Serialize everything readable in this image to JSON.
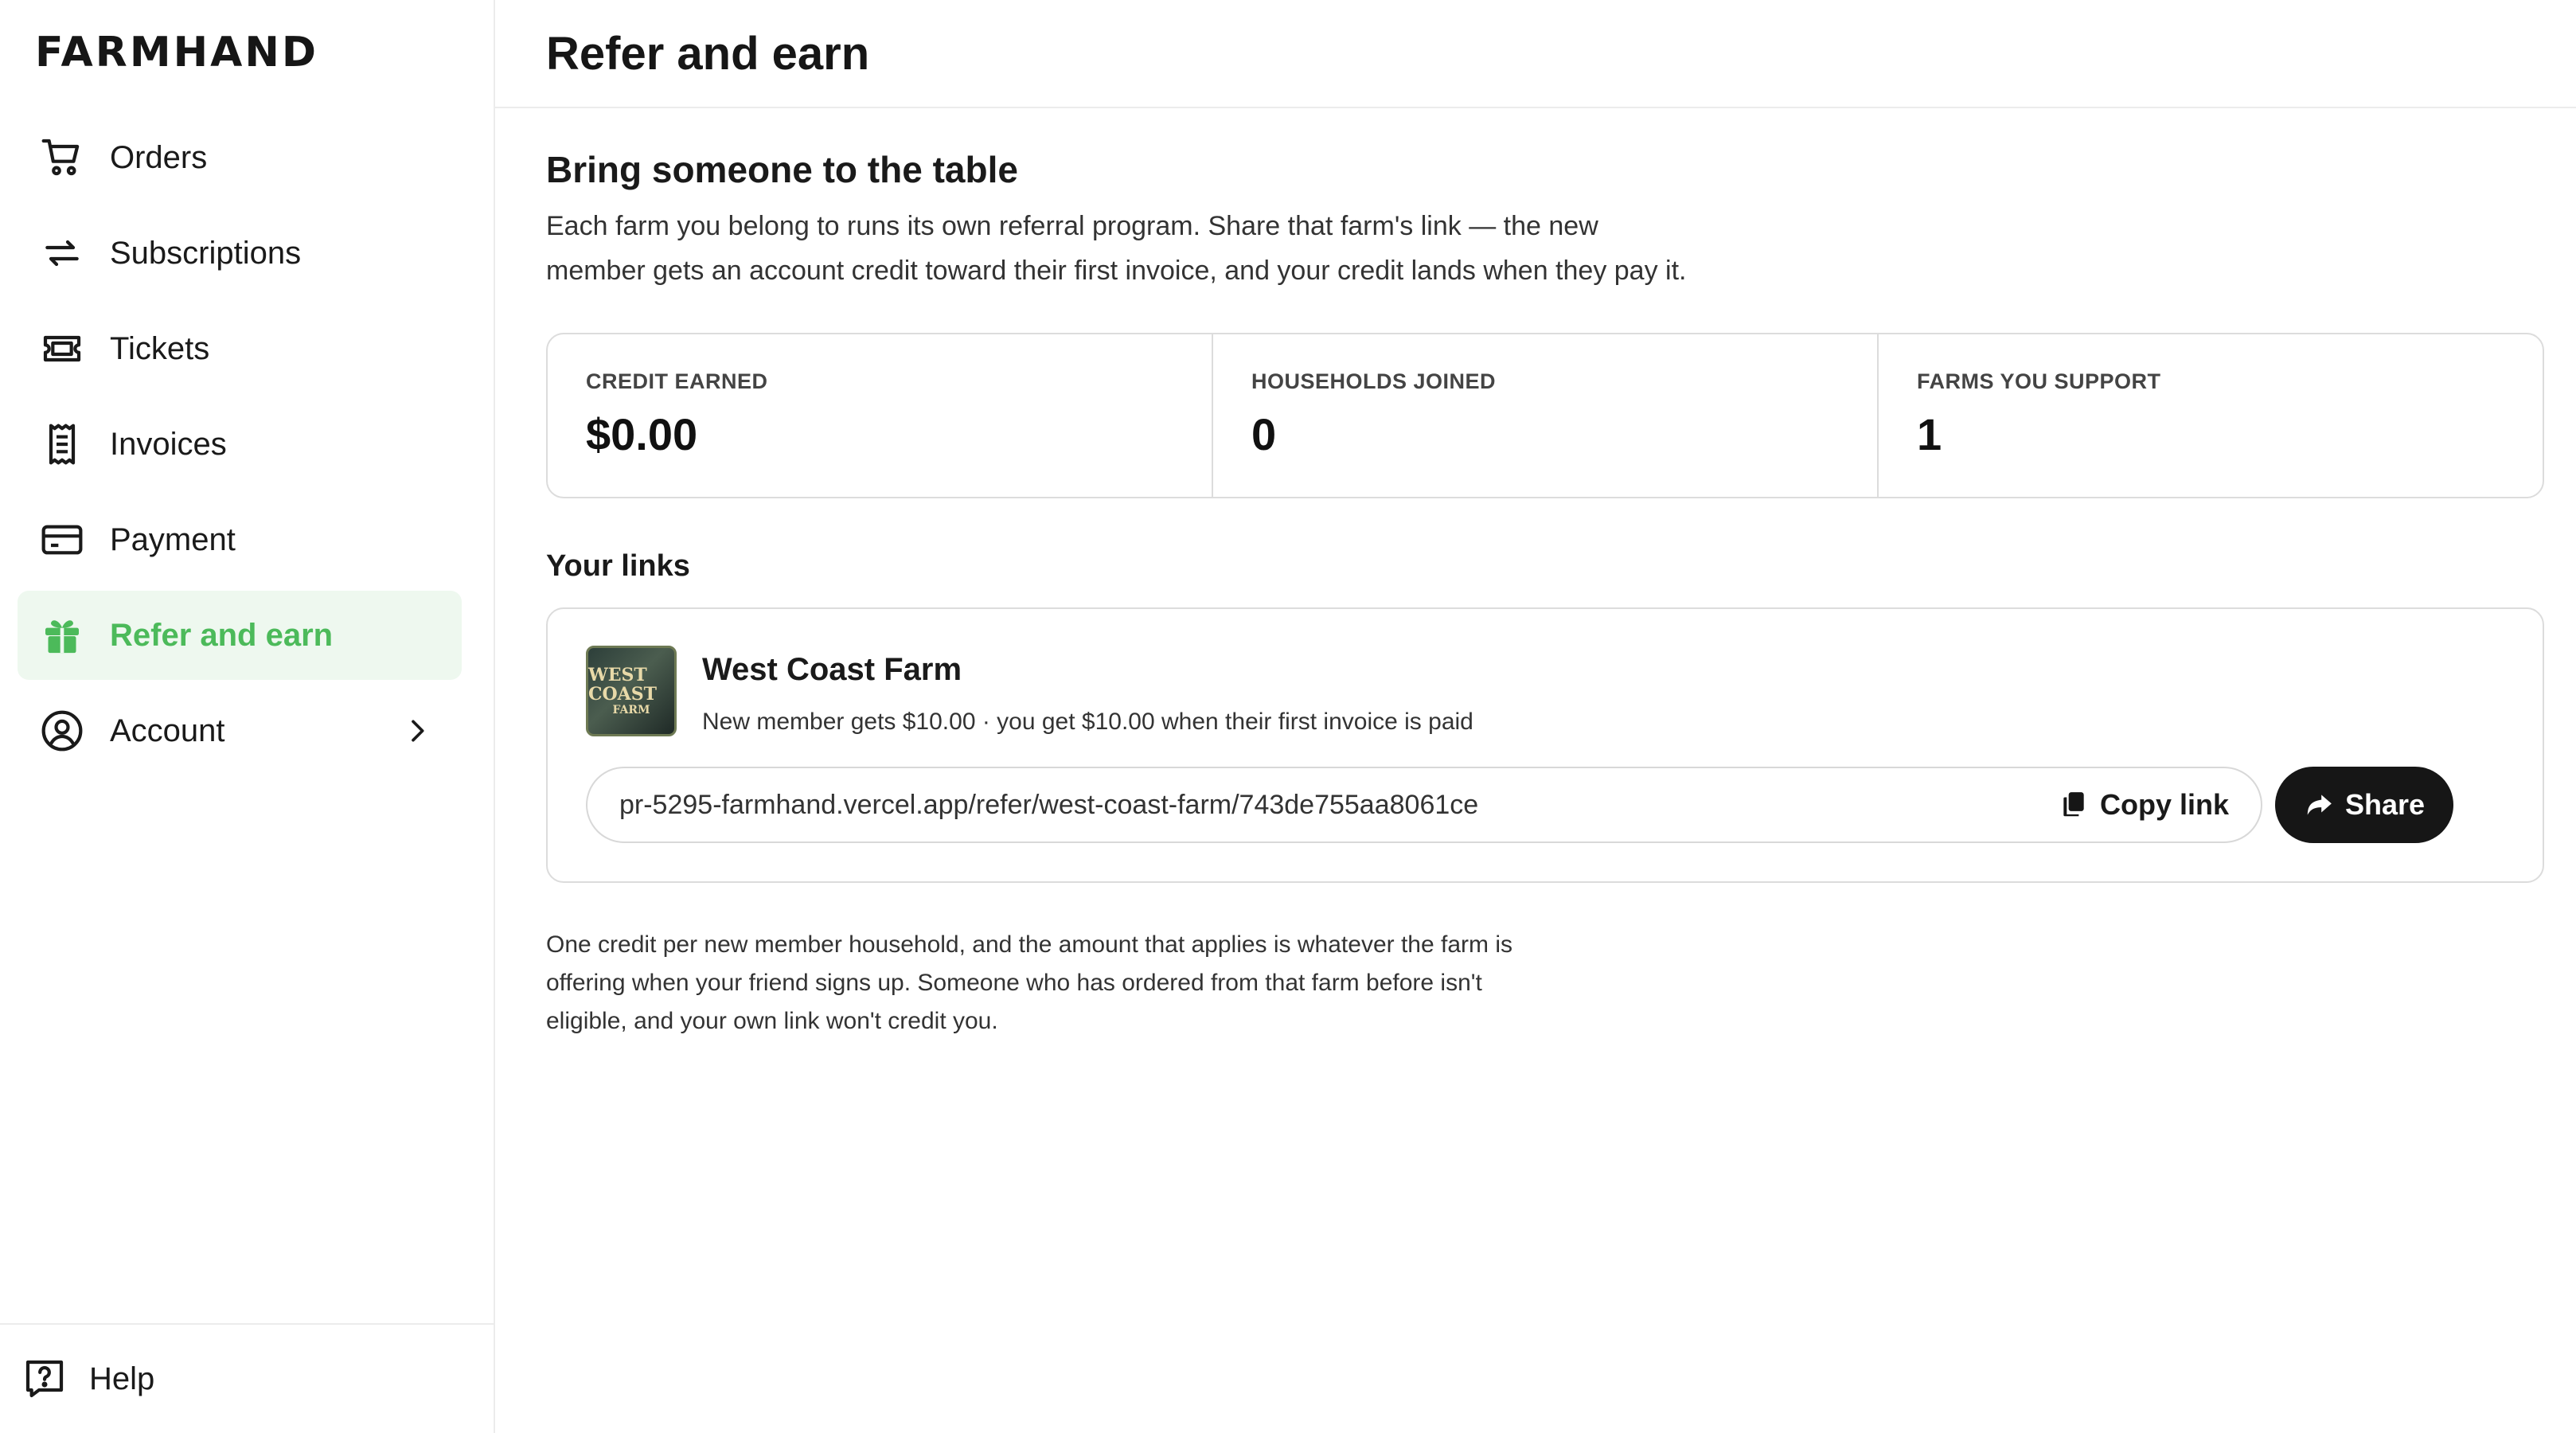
{
  "brand": {
    "logo": "FARMHAND"
  },
  "sidebar": {
    "items": [
      {
        "label": "Orders",
        "icon": "cart-icon"
      },
      {
        "label": "Subscriptions",
        "icon": "repeat-icon"
      },
      {
        "label": "Tickets",
        "icon": "ticket-icon"
      },
      {
        "label": "Invoices",
        "icon": "receipt-icon"
      },
      {
        "label": "Payment",
        "icon": "credit-card-icon"
      },
      {
        "label": "Refer and earn",
        "icon": "gift-icon",
        "active": true
      },
      {
        "label": "Account",
        "icon": "user-circle-icon"
      }
    ],
    "help_label": "Help"
  },
  "header": {
    "title": "Refer and earn"
  },
  "intro": {
    "title": "Bring someone to the table",
    "text": "Each farm you belong to runs its own referral program. Share that farm's link — the new member gets an account credit toward their first invoice, and your credit lands when they pay it."
  },
  "stats": [
    {
      "label": "CREDIT EARNED",
      "value": "$0.00"
    },
    {
      "label": "HOUSEHOLDS JOINED",
      "value": "0"
    },
    {
      "label": "FARMS YOU SUPPORT",
      "value": "1"
    }
  ],
  "links": {
    "title": "Your links",
    "farm": {
      "name": "West Coast Farm",
      "logo_text": "WEST COAST",
      "logo_subtext": "FARM",
      "description": "New member gets $10.00 · you get $10.00 when their first invoice is paid",
      "url": "pr-5295-farmhand.vercel.app/refer/west-coast-farm/743de755aa8061ce",
      "copy_label": "Copy link",
      "share_label": "Share"
    }
  },
  "footnote": "One credit per new member household, and the amount that applies is whatever the farm is offering when your friend signs up. Someone who has ordered from that farm before isn't eligible, and your own link won't credit you.",
  "colors": {
    "accent": "#4cba5a",
    "active_bg": "#eef8ef",
    "dark": "#161616"
  }
}
